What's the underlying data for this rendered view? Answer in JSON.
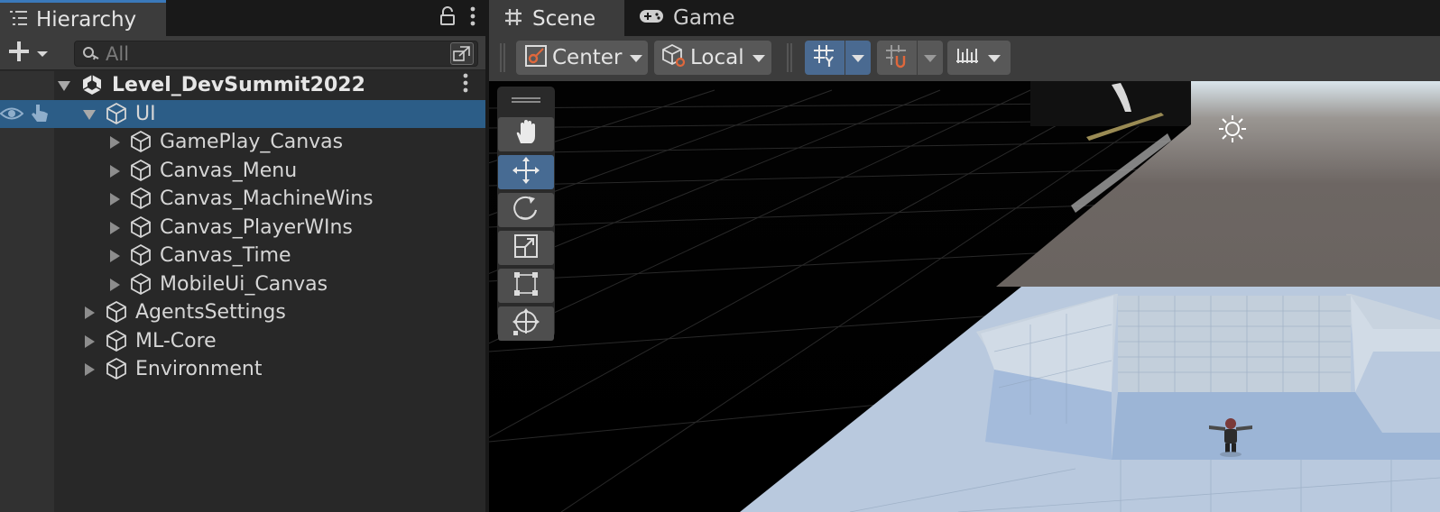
{
  "hierarchy": {
    "tab_label": "Hierarchy",
    "search_placeholder": "All",
    "tree": [
      {
        "label": "Level_DevSummit2022",
        "kind": "scene",
        "indent": 0,
        "expanded": true
      },
      {
        "label": "UI",
        "kind": "object",
        "indent": 1,
        "expanded": true,
        "selected": true
      },
      {
        "label": "GamePlay_Canvas",
        "kind": "object",
        "indent": 2,
        "expanded": false
      },
      {
        "label": "Canvas_Menu",
        "kind": "object",
        "indent": 2,
        "expanded": false
      },
      {
        "label": "Canvas_MachineWins",
        "kind": "object",
        "indent": 2,
        "expanded": false
      },
      {
        "label": "Canvas_PlayerWIns",
        "kind": "object",
        "indent": 2,
        "expanded": false
      },
      {
        "label": "Canvas_Time",
        "kind": "object",
        "indent": 2,
        "expanded": false
      },
      {
        "label": "MobileUi_Canvas",
        "kind": "object",
        "indent": 2,
        "expanded": false
      },
      {
        "label": "AgentsSettings",
        "kind": "object",
        "indent": 1,
        "expanded": false
      },
      {
        "label": "ML-Core",
        "kind": "object",
        "indent": 1,
        "expanded": false
      },
      {
        "label": "Environment",
        "kind": "object",
        "indent": 1,
        "expanded": false
      }
    ]
  },
  "scene": {
    "tabs": [
      {
        "label": "Scene",
        "icon": "grid-hash-icon",
        "active": true
      },
      {
        "label": "Game",
        "icon": "gamepad-icon",
        "active": false
      }
    ],
    "toolbar": {
      "pivot_label": "Center",
      "space_label": "Local"
    },
    "tools": [
      {
        "name": "hand-tool",
        "active": false
      },
      {
        "name": "move-tool",
        "active": true
      },
      {
        "name": "rotate-tool",
        "active": false
      },
      {
        "name": "scale-tool",
        "active": false
      },
      {
        "name": "rect-tool",
        "active": false
      },
      {
        "name": "transform-tool",
        "active": false
      }
    ]
  },
  "colors": {
    "selection": "#2c5d87",
    "accent_blue": "#3a79bb",
    "panel_bg": "#282828",
    "toolbar_bg": "#3c3c3c",
    "floor_blue": "#b9c9de",
    "sky_gray": "#6d6663"
  }
}
